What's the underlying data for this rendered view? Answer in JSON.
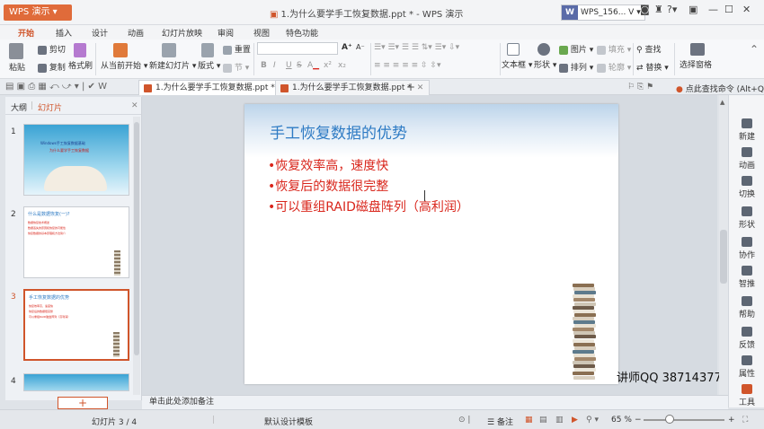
{
  "app": {
    "button": "WPS 演示",
    "title": "1.为什么要学手工恢复数据.ppt * - WPS 演示",
    "user": "WPS_156... V",
    "help": "?"
  },
  "menu": [
    "开始",
    "插入",
    "设计",
    "动画",
    "幻灯片放映",
    "审阅",
    "视图",
    "特色功能"
  ],
  "ribbon": {
    "paste": "粘贴",
    "cut": "剪切",
    "copy": "复制",
    "format_painter": "格式刷",
    "from_current": "从当前开始",
    "new_slide": "新建幻灯片",
    "layout": "版式",
    "section": "节",
    "reset": "重置",
    "textbox": "文本框",
    "shape": "形状",
    "picture": "图片",
    "fill": "填充",
    "arrange": "排列",
    "outline": "轮廓",
    "find": "查找",
    "replace": "替换",
    "select_pane": "选择窗格",
    "font_size_a_up": "A",
    "font_size_a_down": "A",
    "bold": "B",
    "italic": "I",
    "underline": "U",
    "strike": "S"
  },
  "tabs": [
    {
      "label": "1.为什么要学手工恢复数据.ppt *"
    },
    {
      "label": "1.为什么要学手工恢复数据.ppt *"
    }
  ],
  "tabbar_right": "点此查找命令 (Alt+Q)",
  "left_panel": {
    "tab_outline": "大纲",
    "tab_slides": "幻灯片",
    "add": "+"
  },
  "thumbs": [
    {
      "num": "1",
      "line1": "Windows手工恢复数据基础",
      "line2": "为什么要学手工恢复数据"
    },
    {
      "num": "2",
      "title": "什么是数据恢复(一)?",
      "lines": [
        "数据恢复技术概述",
        "数据丢失的原因和恢复的可能性",
        "恢复数据的基本原理和方法简介"
      ]
    },
    {
      "num": "3",
      "title": "手工恢复数据的优势",
      "lines": [
        "恢复效率高，速度快",
        "恢复后的数据很完整",
        "可以重组RAID磁盘阵列（高利润）"
      ]
    },
    {
      "num": "4"
    }
  ],
  "slide": {
    "title": "手工恢复数据的优势",
    "bullets": [
      "•恢复效率高，速度快",
      "•恢复后的数据很完整",
      "•可以重组RAID磁盘阵列（高利润）"
    ]
  },
  "watermark": "讲师QQ 38714377",
  "right_tools": [
    "新建",
    "动画",
    "切换",
    "形状",
    "协作",
    "智推",
    "帮助",
    "反馈",
    "属性",
    "工具"
  ],
  "notes_placeholder": "单击此处添加备注",
  "status": {
    "slide_pos": "幻灯片 3 / 4",
    "template": "默认设计模板",
    "notes": "备注",
    "zoom": "65 %",
    "zoom_minus": "−",
    "zoom_plus": "+"
  },
  "colors": {
    "accent": "#d0552b",
    "title_blue": "#2e7bc4",
    "bullet_red": "#d9261c"
  }
}
